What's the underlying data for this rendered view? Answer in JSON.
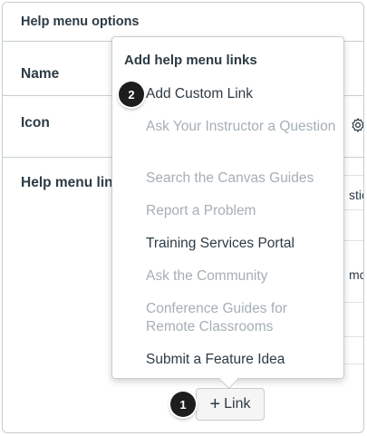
{
  "section": {
    "title": "Help menu options"
  },
  "rows": {
    "name_label": "Name",
    "icon_label": "Icon",
    "help_links_label": "Help menu lin"
  },
  "clipped_text": {
    "t1": "stio",
    "t2": "mc"
  },
  "menu": {
    "heading": "Add help menu links",
    "items": [
      {
        "label": "Add Custom Link",
        "state": "enabled"
      },
      {
        "label": "Ask Your Instructor a Question",
        "state": "disabled"
      },
      {
        "label": "Search the Canvas Guides",
        "state": "disabled"
      },
      {
        "label": "Report a Problem",
        "state": "disabled"
      },
      {
        "label": "Training Services Portal",
        "state": "enabled"
      },
      {
        "label": "Ask the Community",
        "state": "disabled"
      },
      {
        "label": "Conference Guides for Remote Classrooms",
        "state": "disabled"
      },
      {
        "label": "Submit a Feature Idea",
        "state": "enabled"
      }
    ]
  },
  "add_link_button": {
    "icon": "plus-icon",
    "label": "Link"
  },
  "callouts": {
    "step1": "1",
    "step2": "2"
  },
  "colors": {
    "text": "#2d3b45",
    "disabled": "#a5afb5",
    "border": "#c7cdd1"
  }
}
